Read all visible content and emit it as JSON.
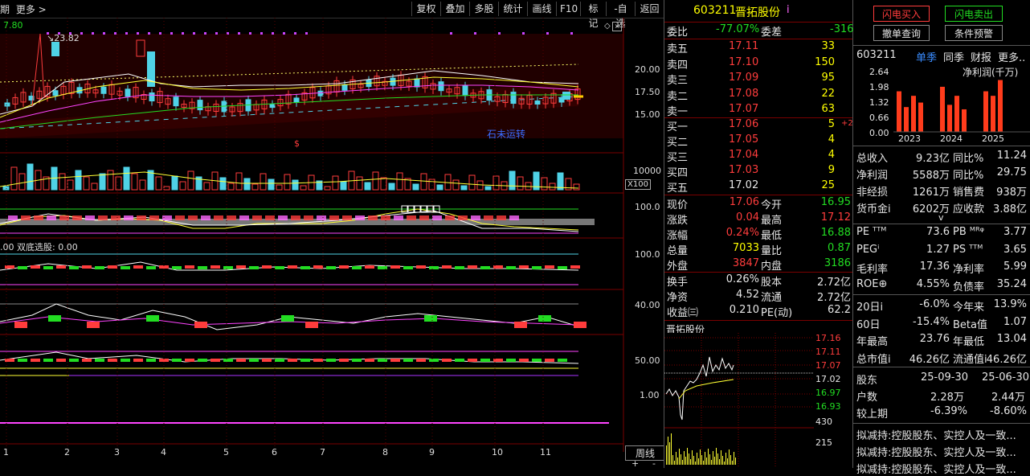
{
  "toolbar": {
    "left_label": "期",
    "more_label": "更多 >",
    "buttons": [
      "复权",
      "叠加",
      "多股",
      "统计",
      "画线",
      "F10",
      "标记",
      "-自选",
      "返回"
    ]
  },
  "main_chart": {
    "top_value": "7.80",
    "high_label": "23.82",
    "price_axis": [
      "20.00",
      "17.50",
      "15.00"
    ],
    "vol_axis": [
      "10000"
    ],
    "vol_unit": "X100",
    "ind1_axis": "100.0",
    "ind2_label": ".00",
    "ind2_name": "双底选股: 0.00",
    "ind2_axis": "100.0",
    "ind3_axis": "40.00",
    "ind4_axis": [
      "50.00",
      "1.00"
    ],
    "annotation": "石未运转",
    "s_mark": "$",
    "month_labels": [
      "1",
      "2",
      "3",
      "4",
      "5",
      "6",
      "7",
      "8",
      "9",
      "10",
      "11"
    ],
    "period_label": "周线",
    "zoom_plus": "+",
    "zoom_minus": "-"
  },
  "quote": {
    "code": "603211",
    "name": "晋拓股份",
    "info_mark": "i",
    "weibi_label": "委比",
    "weibi": "-77.07%",
    "weicha_label": "委差",
    "weicha": "-316",
    "asks": [
      {
        "label": "卖五",
        "price": "17.11",
        "vol": "33"
      },
      {
        "label": "卖四",
        "price": "17.10",
        "vol": "150"
      },
      {
        "label": "卖三",
        "price": "17.09",
        "vol": "95"
      },
      {
        "label": "卖二",
        "price": "17.08",
        "vol": "22"
      },
      {
        "label": "卖一",
        "price": "17.07",
        "vol": "63"
      }
    ],
    "bids": [
      {
        "label": "买一",
        "price": "17.06",
        "vol": "5",
        "extra": "+2"
      },
      {
        "label": "买二",
        "price": "17.05",
        "vol": "4",
        "extra": ""
      },
      {
        "label": "买三",
        "price": "17.04",
        "vol": "4",
        "extra": ""
      },
      {
        "label": "买四",
        "price": "17.03",
        "vol": "9",
        "extra": ""
      },
      {
        "label": "买五",
        "price": "17.02",
        "vol": "25",
        "extra": ""
      }
    ],
    "stats": [
      {
        "l1": "现价",
        "v1": "17.06",
        "l2": "今开",
        "v2": "16.95"
      },
      {
        "l1": "涨跌",
        "v1": "0.04",
        "l2": "最高",
        "v2": "17.12"
      },
      {
        "l1": "涨幅",
        "v1": "0.24%",
        "l2": "最低",
        "v2": "16.88"
      },
      {
        "l1": "总量",
        "v1": "7033",
        "l2": "量比",
        "v2": "0.87"
      },
      {
        "l1": "外盘",
        "v1": "3847",
        "l2": "内盘",
        "v2": "3186"
      }
    ],
    "stats2": [
      {
        "l1": "换手",
        "v1": "0.26%",
        "l2": "股本",
        "v2": "2.72亿"
      },
      {
        "l1": "净资",
        "v1": "4.52",
        "l2": "流通",
        "v2": "2.72亿"
      },
      {
        "l1": "收益㈢",
        "v1": "0.210",
        "l2": "PE(动)",
        "v2": "62.2"
      }
    ],
    "mini_title": "晋拓股份",
    "mini_axis": [
      "17.16",
      "17.11",
      "17.07",
      "17.02",
      "16.97",
      "16.93"
    ],
    "mini_vol_axis": [
      "430",
      "215"
    ]
  },
  "f10": {
    "btn_buy": "闪电买入",
    "btn_sell": "闪电卖出",
    "btn_cancel": "撤单查询",
    "btn_cond": "条件预警",
    "code": "603211",
    "tabs": [
      "单季",
      "同季",
      "财报",
      "更多.."
    ],
    "bar_axis": [
      "2.64",
      "1.98",
      "1.32",
      "0.66",
      "0.00"
    ],
    "bar_title": "净利润(千万)",
    "bar_years": [
      "2023",
      "2024",
      "2025"
    ],
    "bar_values": [
      1.8,
      1.1,
      1.6,
      1.3,
      2.0,
      1.2,
      1.6,
      1.0,
      1.8,
      1.6,
      2.3
    ],
    "rows1": [
      {
        "l1": "总收入",
        "v1": "9.23亿",
        "l2": "同比%",
        "v2": "11.24"
      },
      {
        "l1": "净利润",
        "v1": "5588万",
        "l2": "同比%",
        "v2": "29.75"
      },
      {
        "l1": "非经损",
        "v1": "1261万",
        "l2": "销售费",
        "v2": "938万"
      },
      {
        "l1": "货币金i",
        "v1": "6202万",
        "l2": "应收款",
        "v2": "3.88亿"
      }
    ],
    "chevron": "v",
    "rows2": [
      {
        "l1": "PE ᵀᵀᴹ",
        "v1": "73.6",
        "l2": "PB ᴹᴿᵠ",
        "v2": "3.77"
      },
      {
        "l1": "PEGⁱ",
        "v1": "1.27",
        "l2": "PS ᵀᵀᴹ",
        "v2": "3.65"
      },
      {
        "l1": "毛利率",
        "v1": "17.36",
        "l2": "净利率",
        "v2": "5.99"
      },
      {
        "l1": "ROE⊕",
        "v1": "4.55%",
        "l2": "负债率",
        "v2": "35.24"
      }
    ],
    "rows3": [
      {
        "l1": "20日i",
        "v1": "-6.0%",
        "l2": "今年来",
        "v2": "13.9%"
      },
      {
        "l1": "60日",
        "v1": "-15.4%",
        "l2": "Beta值",
        "v2": "1.07"
      },
      {
        "l1": "年最高",
        "v1": "23.76",
        "l2": "年最低",
        "v2": "13.04"
      },
      {
        "l1": "总市值i",
        "v1": "46.26亿",
        "l2": "流通值i",
        "v2": "46.26亿"
      }
    ],
    "holders": {
      "label": "股东",
      "d1": "25-09-30",
      "d2": "25-06-30"
    },
    "households": {
      "label": "户数",
      "v1": "2.28万",
      "v2": "2.44万"
    },
    "compare": {
      "label": "较上期",
      "v1": "-6.39%",
      "v2": "-8.60%"
    },
    "news": [
      "拟减持:控股股东、实控人及一致...",
      "拟减持:控股股东、实控人及一致...",
      "拟减持:控股股东、实控人及一致..."
    ]
  }
}
